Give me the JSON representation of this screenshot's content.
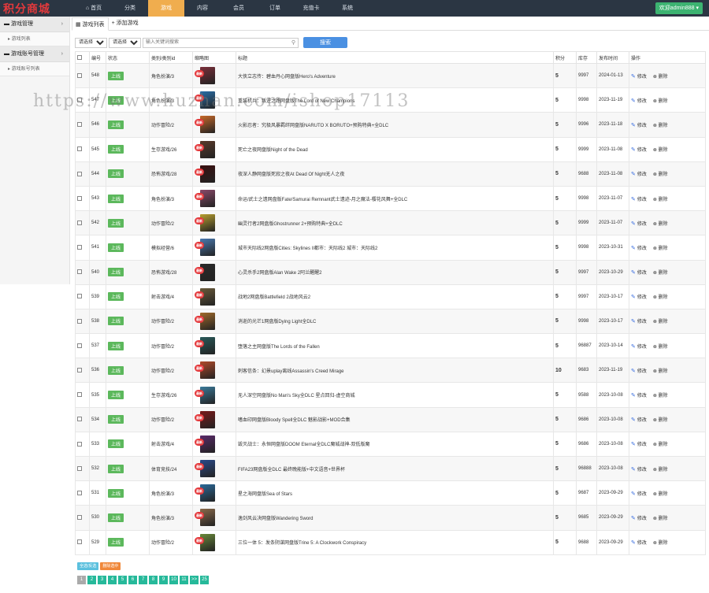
{
  "brand": "积分商城",
  "topnav": [
    {
      "label": "⌂ 首页",
      "active": false
    },
    {
      "label": "分类",
      "active": false
    },
    {
      "label": "游戏",
      "active": true
    },
    {
      "label": "内容",
      "active": false
    },
    {
      "label": "会员",
      "active": false
    },
    {
      "label": "订单",
      "active": false
    },
    {
      "label": "充值卡",
      "active": false
    },
    {
      "label": "系统",
      "active": false
    }
  ],
  "welcome": "欢迎admin888 ▾",
  "sidebar": [
    {
      "group": "游戏管理",
      "items": [
        "游戏列表"
      ]
    },
    {
      "group": "游戏账号管理",
      "items": [
        "游戏账号列表"
      ]
    }
  ],
  "tabs": [
    {
      "label": "游戏列表",
      "active": true
    },
    {
      "label": "添加游戏",
      "active": false
    }
  ],
  "filters": {
    "select1": "请选择",
    "select2": "请选择",
    "search_placeholder": "输入关键词搜索",
    "search_button": "搜索"
  },
  "table": {
    "headers": [
      "",
      "编号",
      "状态",
      "类别/类别id",
      "缩略图",
      "标题",
      "积分",
      "库存",
      "发布时间",
      "操作"
    ],
    "status_label": "上线",
    "hot_label": "最新",
    "edit_label": "修改",
    "delete_label": "删除",
    "rows": [
      {
        "id": "548",
        "category": "角色扮演/3",
        "title": "大侠立志传：碧血丹心网盘版Hero's Adventure",
        "score": "5",
        "stock": "9997",
        "date": "2024-01-13",
        "thumb": "#7a2f3a"
      },
      {
        "id": "547",
        "category": "角色扮演/3",
        "title": "重装机兵：叛逆之路网盘版The Lord of New Champions",
        "score": "5",
        "stock": "9998",
        "date": "2023-11-19",
        "thumb": "#2a6fa8"
      },
      {
        "id": "546",
        "category": "动作冒险/2",
        "title": "火影忍者：究极风暴羁绊网盘版NARUTO X BORUTO+预购特典+全DLC",
        "score": "5",
        "stock": "9996",
        "date": "2023-11-18",
        "thumb": "#c86a2a"
      },
      {
        "id": "545",
        "category": "生存游戏/26",
        "title": "死亡之夜网盘版Night of the Dead",
        "score": "5",
        "stock": "9999",
        "date": "2023-11-08",
        "thumb": "#5a3a2a"
      },
      {
        "id": "544",
        "category": "恐怖游戏/28",
        "title": "夜深人静网盘版死寂之夜At Dead Of Night无人之夜",
        "score": "5",
        "stock": "9688",
        "date": "2023-11-08",
        "thumb": "#3a1010"
      },
      {
        "id": "543",
        "category": "角色扮演/3",
        "title": "命运/武士之遗网盘版Fate/Samurai Remnant武士遗迹-月之魔法-樱花风舞+全DLC",
        "score": "5",
        "stock": "9998",
        "date": "2023-11-07",
        "thumb": "#8a4a6a"
      },
      {
        "id": "542",
        "category": "动作冒险/2",
        "title": "幽灵行者2网盘版Ghostrunner 2+预购特典+全DLC",
        "score": "5",
        "stock": "9999",
        "date": "2023-11-07",
        "thumb": "#b8a030"
      },
      {
        "id": "541",
        "category": "模拟经营/6",
        "title": "城市天际线2网盘版Cities: Skylines II都市：天际线2 城市：天际线2",
        "score": "5",
        "stock": "9998",
        "date": "2023-10-31",
        "thumb": "#4a7ab0"
      },
      {
        "id": "540",
        "category": "恐怖游戏/28",
        "title": "心灵杀手2网盘版Alan Wake 2阿兰醒醒2",
        "score": "5",
        "stock": "9997",
        "date": "2023-10-29",
        "thumb": "#2a2a2a"
      },
      {
        "id": "539",
        "category": "射击游戏/4",
        "title": "战地2网盘版Battlefield 2战地风云2",
        "score": "5",
        "stock": "9997",
        "date": "2023-10-17",
        "thumb": "#6a5a3a"
      },
      {
        "id": "538",
        "category": "动作冒险/2",
        "title": "消逝的光芒1网盘版Dying Light全DLC",
        "score": "5",
        "stock": "9998",
        "date": "2023-10-17",
        "thumb": "#a06a2a"
      },
      {
        "id": "537",
        "category": "动作冒险/2",
        "title": "堕落之主网盘版The Lords of the Fallen",
        "score": "5",
        "stock": "96887",
        "date": "2023-10-14",
        "thumb": "#2a5a5a"
      },
      {
        "id": "536",
        "category": "动作冒险/2",
        "title": "刺客信条：幻景uplay离线Assassin's Creed Mirage",
        "score": "10",
        "stock": "9683",
        "date": "2023-11-19",
        "thumb": "#b04a2a"
      },
      {
        "id": "535",
        "category": "生存游戏/26",
        "title": "无人深空网盘版No Man's Sky全DLC 星点回归-虚空商城",
        "score": "5",
        "stock": "9588",
        "date": "2023-10-08",
        "thumb": "#3a7a9a"
      },
      {
        "id": "534",
        "category": "动作冒险/2",
        "title": "嗜血印网盘版Bloody Spell全DLC 魅影战影+MOD合集",
        "score": "5",
        "stock": "9686",
        "date": "2023-10-08",
        "thumb": "#7a1a1a"
      },
      {
        "id": "533",
        "category": "射击游戏/4",
        "title": "毁灭战士：永恒网盘版DOOM Eternal全DLC魔城战神-双低版魔",
        "score": "5",
        "stock": "9686",
        "date": "2023-10-08",
        "thumb": "#5a2a6a"
      },
      {
        "id": "532",
        "category": "体育竞技/24",
        "title": "FIFA23网盘版全DLC 最终晚能版+中文语音+世界杯",
        "score": "5",
        "stock": "96888",
        "date": "2023-10-08",
        "thumb": "#2a4a8a"
      },
      {
        "id": "531",
        "category": "角色扮演/3",
        "title": "星之海网盘版Sea of Stars",
        "score": "5",
        "stock": "9687",
        "date": "2023-09-29",
        "thumb": "#2a6a9a"
      },
      {
        "id": "530",
        "category": "角色扮演/3",
        "title": "逸剑风云决网盘版Wandering Sword",
        "score": "5",
        "stock": "9685",
        "date": "2023-09-29",
        "thumb": "#8a6a4a"
      },
      {
        "id": "529",
        "category": "动作冒险/2",
        "title": "三位一体 5：发条阴谋网盘版Trine 5: A Clockwork Conspiracy",
        "score": "5",
        "stock": "9688",
        "date": "2023-09-29",
        "thumb": "#6a8a3a"
      }
    ]
  },
  "bottom_buttons": {
    "select_all": "全选/反选",
    "delete_selected": "删除选中"
  },
  "pager": {
    "current": "1",
    "pages": [
      "2",
      "3",
      "4",
      "5",
      "6",
      "7",
      "8",
      "9",
      "10",
      "11"
    ],
    "next": ">>",
    "last": "25"
  },
  "watermark": "https://www.huzhan.com/ishop17113",
  "colors": {
    "topbar": "#2b3643",
    "active_nav": "#f0ad4e",
    "online_badge": "#5cb85c",
    "search_button": "#4a90e2",
    "pager": "#26b99a",
    "brand": "#e4393c"
  }
}
